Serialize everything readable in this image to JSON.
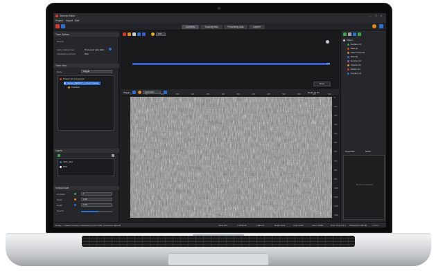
{
  "app": {
    "title": "Seismic Editor",
    "menu": [
      "Project",
      "Import",
      "Edit"
    ],
    "window_controls": [
      "–",
      "□",
      "×"
    ]
  },
  "toolbar": {
    "tabs": [
      {
        "label": "Overview",
        "active": true
      },
      {
        "label": "Tracking data",
        "active": false
      },
      {
        "label": "Processing data",
        "active": false
      },
      {
        "label": "Inspect",
        "active": false
      }
    ]
  },
  "left_panel": {
    "section1_title": "Trace Options",
    "source_label": "Source",
    "rows": [
      {
        "label": "Apply scaling rules",
        "value": "Processed data (AR)"
      },
      {
        "label": "Interleaving sources",
        "value": "RS1"
      }
    ],
    "section2_title": "Trace View",
    "mode_label": "Mode",
    "mode_value": "Wiggle",
    "tree": [
      {
        "label": "Project 101 (1 layer(s))",
        "color": "#d23b2e"
      },
      {
        "label": "Survey_RESULT_1 (3 of 3 traces)",
        "color": "#2d6fd0",
        "highlight": true
      },
      {
        "label": "Inversion",
        "color": "#e08a1e"
      }
    ],
    "layers_title": "Layers",
    "layers": [
      {
        "label": "Inline data",
        "color": "#2d6fd0"
      },
      {
        "label": "Pick",
        "color": "#ffffff"
      }
    ],
    "section3_title": "Vertical Scale",
    "controls": [
      {
        "label": "Constant",
        "value": "1",
        "color": "#3fa34d"
      },
      {
        "label": "Scale",
        "value": "1.00",
        "color": "#e08a1e"
      },
      {
        "label": "Depth",
        "value": "1.00",
        "color": "#2d6fd0"
      },
      {
        "label": "Opacity",
        "value": "",
        "level": 0.55
      }
    ]
  },
  "center": {
    "zoom_value": "100",
    "view_toolbar_label": "Wiggle",
    "view_toolbar_select": "Automatic",
    "view_toolbar_right": "Depth 10 km",
    "track_value": "0.00",
    "track_right_label": "Move",
    "x_ticks": [
      "0",
      "50",
      "100",
      "150",
      "200",
      "250",
      "300",
      "350",
      "400",
      "450",
      "500",
      "550",
      "600",
      "650"
    ],
    "y_ticks": [
      "0",
      "100",
      "200",
      "300",
      "400",
      "500",
      "600",
      "700",
      "800",
      "900",
      "1000",
      "1100",
      "1200",
      "1300"
    ]
  },
  "right_panel": {
    "tree": [
      {
        "label": "Object",
        "color": "#c9cdd1"
      },
      {
        "label": "Surface (3)",
        "color": "#3fa34d"
      },
      {
        "label": "Well (2)",
        "color": "#d23b2e"
      },
      {
        "label": "Fault traces (3)",
        "color": "#e08a1e"
      },
      {
        "label": "Pick (5)",
        "color": "#2d6fd0"
      },
      {
        "label": "Horizon (4)",
        "color": "#9b59b6"
      },
      {
        "label": "Volume (4)",
        "color": "#e08a1e"
      },
      {
        "label": "Marker (2)",
        "color": "#d23b2e"
      },
      {
        "label": "Polyline (2)",
        "color": "#2d6fd0"
      }
    ],
    "bottom_tabs": [
      "Properties",
      "Notes"
    ],
    "empty_message": "No items selected"
  },
  "statusbar": {
    "left": "Ready — loaded 3 traces, interleaving source RS1, processed data AR",
    "items": [
      "Inline 231",
      "X 1032.45",
      "Y 880.12",
      "Depth 1041",
      "Amp 0.432",
      "Zoom 100%",
      "Proc. Time 0.3 s",
      "Streamed 1.48 GB"
    ],
    "right": "v 2.4.1"
  }
}
